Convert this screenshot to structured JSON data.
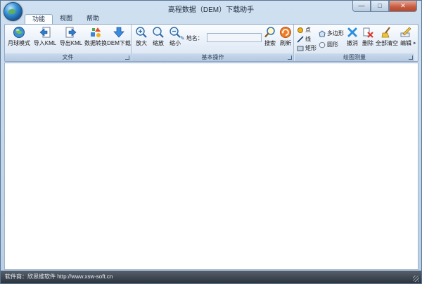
{
  "window": {
    "title": "高程数据（DEM）下载助手"
  },
  "window_controls": {
    "minimize": "—",
    "maximize": "□",
    "close": "✕"
  },
  "tabs": [
    {
      "label": "功能",
      "active": true
    },
    {
      "label": "视图",
      "active": false
    },
    {
      "label": "帮助",
      "active": false
    }
  ],
  "groups": {
    "file": {
      "label": "文件",
      "buttons": [
        {
          "label": "月球模式",
          "icon": "globe-icon"
        },
        {
          "label": "导入KML",
          "icon": "import-icon"
        },
        {
          "label": "导出KML",
          "icon": "export-icon"
        },
        {
          "label": "数据转换",
          "icon": "convert-icon"
        },
        {
          "label": "DEM下载",
          "icon": "download-icon"
        }
      ]
    },
    "basic": {
      "label": "基本操作",
      "buttons": [
        {
          "label": "放大",
          "icon": "zoom-in-icon"
        },
        {
          "label": "缩放",
          "icon": "zoom-icon"
        },
        {
          "label": "缩小",
          "icon": "zoom-out-icon"
        }
      ],
      "place_label": "地名：",
      "place_value": "",
      "search": "搜索",
      "refresh": "刷新"
    },
    "draw": {
      "label": "绘图测量",
      "small": [
        {
          "label": "点",
          "icon": "point-icon"
        },
        {
          "label": "线",
          "icon": "line-icon"
        },
        {
          "label": "矩形",
          "icon": "rectangle-icon"
        },
        {
          "label": "多边形",
          "icon": "polygon-icon"
        },
        {
          "label": "圆形",
          "icon": "circle-icon"
        }
      ],
      "buttons": [
        {
          "label": "撤消",
          "icon": "undo-icon"
        },
        {
          "label": "删除",
          "icon": "delete-icon"
        },
        {
          "label": "全部清空",
          "icon": "clear-all-icon"
        },
        {
          "label": "编辑",
          "icon": "edit-icon"
        }
      ]
    }
  },
  "status": {
    "text": "软件商：欣思维软件 http://www.xsw-soft.cn"
  },
  "colors": {
    "ribbon_border": "#93abc6",
    "status_bg": "#2c333c",
    "close_btn": "#c65b3e"
  }
}
